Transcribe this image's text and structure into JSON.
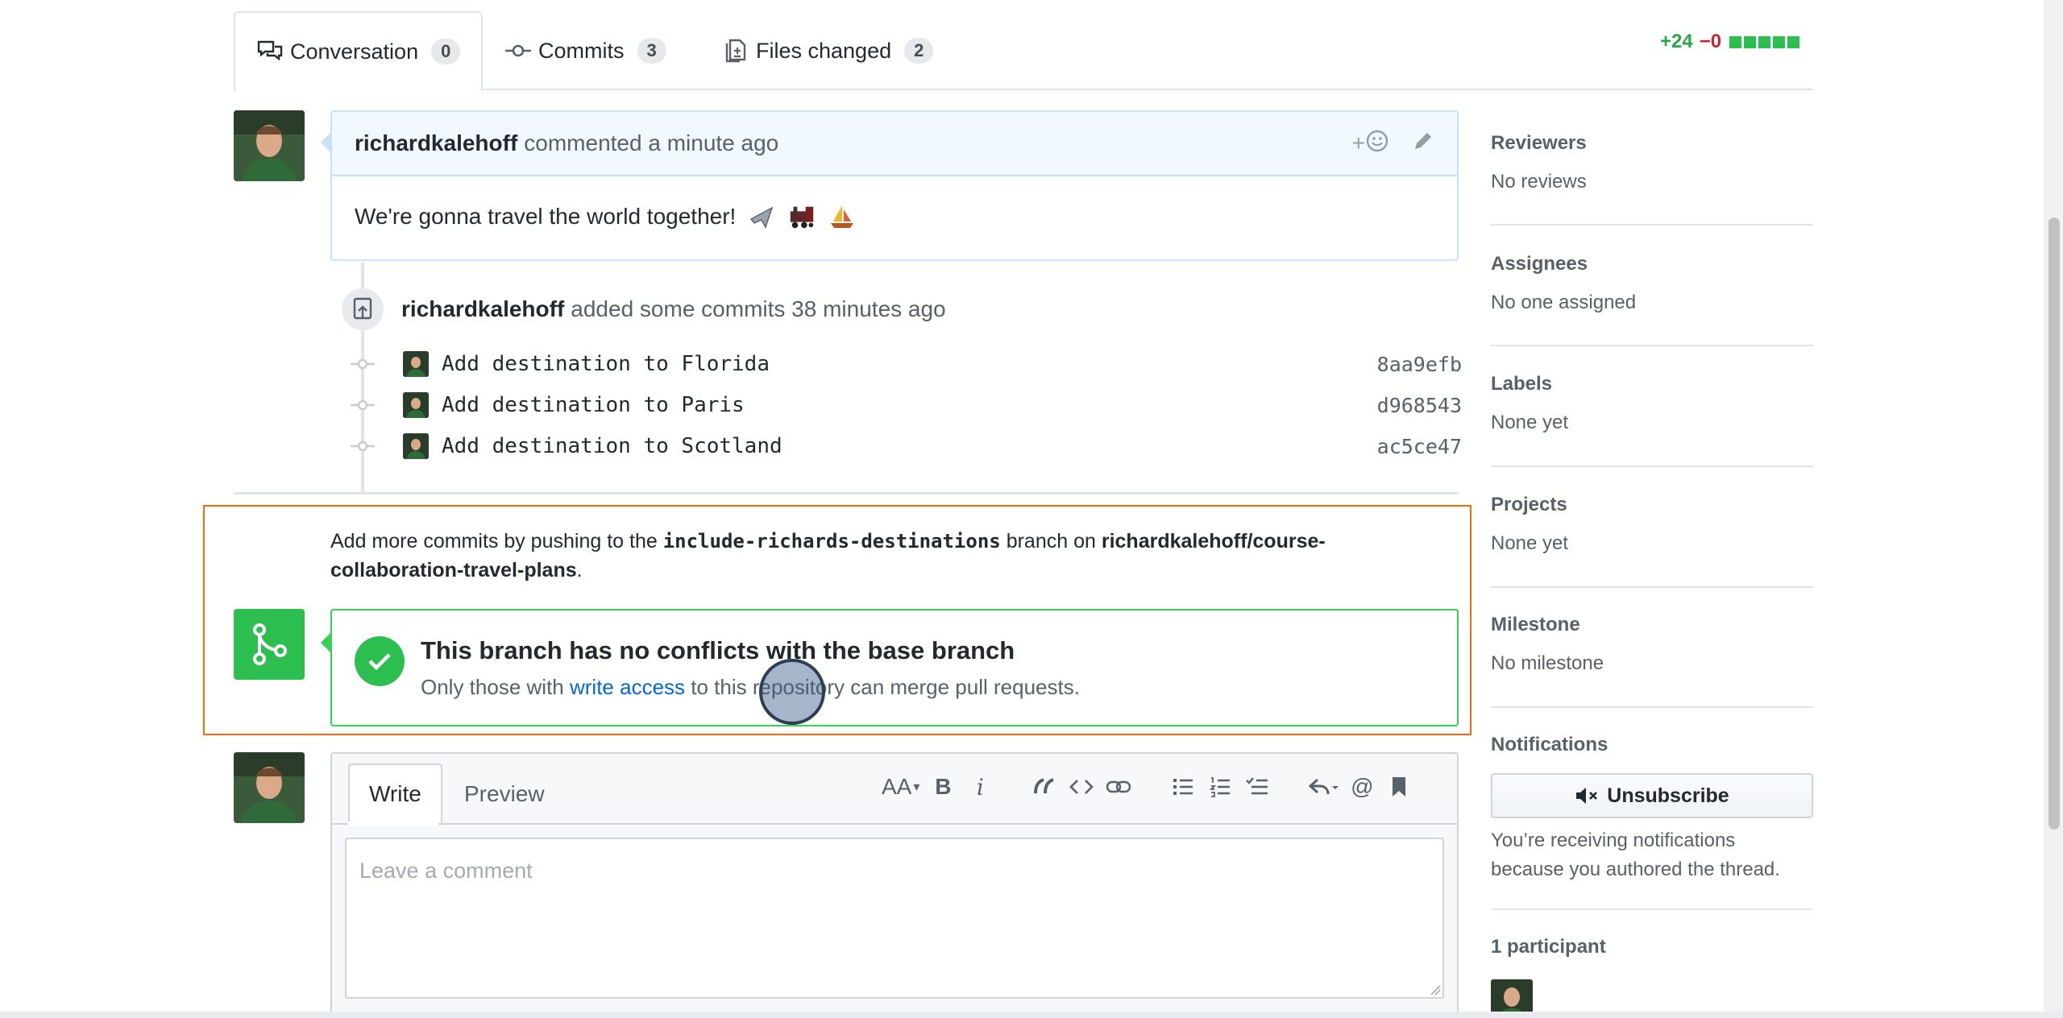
{
  "tabs": [
    {
      "label": "Conversation",
      "count": "0",
      "icon": "comment-discussion-icon"
    },
    {
      "label": "Commits",
      "count": "3",
      "icon": "git-commit-icon"
    },
    {
      "label": "Files changed",
      "count": "2",
      "icon": "file-diff-icon"
    }
  ],
  "diffstat": {
    "additions": "+24",
    "deletions": "−0",
    "blocks": 5,
    "color_add": "#2cbe4e"
  },
  "comment": {
    "author": "richardkalehoff",
    "action": "commented a minute ago",
    "body": "We're gonna travel the world together!",
    "emojis": [
      "airplane-emoji",
      "steam-locomotive-emoji",
      "sailboat-emoji"
    ],
    "reaction_label": "+"
  },
  "commits_event": {
    "author": "richardkalehoff",
    "text": "added some commits 38 minutes ago",
    "commits": [
      {
        "message": "Add destination to Florida",
        "sha": "8aa9efb"
      },
      {
        "message": "Add destination to Paris",
        "sha": "d968543"
      },
      {
        "message": "Add destination to Scotland",
        "sha": "ac5ce47"
      }
    ]
  },
  "push_note": {
    "prefix": "Add more commits by pushing to the",
    "branch": "include-richards-destinations",
    "middle": "branch on",
    "repo_line1": "richardkalehoff/course-",
    "repo_line2": "collaboration-travel-plans",
    "suffix": "."
  },
  "merge": {
    "title": "This branch has no conflicts with the base branch",
    "sub_prefix": "Only those with",
    "sub_link": "write access",
    "sub_suffix": "to this repository can merge pull requests.",
    "color": "#2cbe4e"
  },
  "editor": {
    "tab_write": "Write",
    "tab_preview": "Preview",
    "placeholder": "Leave a comment",
    "toolbar": {
      "heading": "AA",
      "bold": "B",
      "italic": "i",
      "mention": "@"
    }
  },
  "sidebar": {
    "reviewers": {
      "title": "Reviewers",
      "value": "No reviews"
    },
    "assignees": {
      "title": "Assignees",
      "value": "No one assigned"
    },
    "labels": {
      "title": "Labels",
      "value": "None yet"
    },
    "projects": {
      "title": "Projects",
      "value": "None yet"
    },
    "milestone": {
      "title": "Milestone",
      "value": "No milestone"
    },
    "notifications": {
      "title": "Notifications",
      "button": "Unsubscribe",
      "line1": "You’re receiving notifications",
      "line2": "because you authored the thread."
    },
    "participants": {
      "title": "1 participant"
    }
  }
}
